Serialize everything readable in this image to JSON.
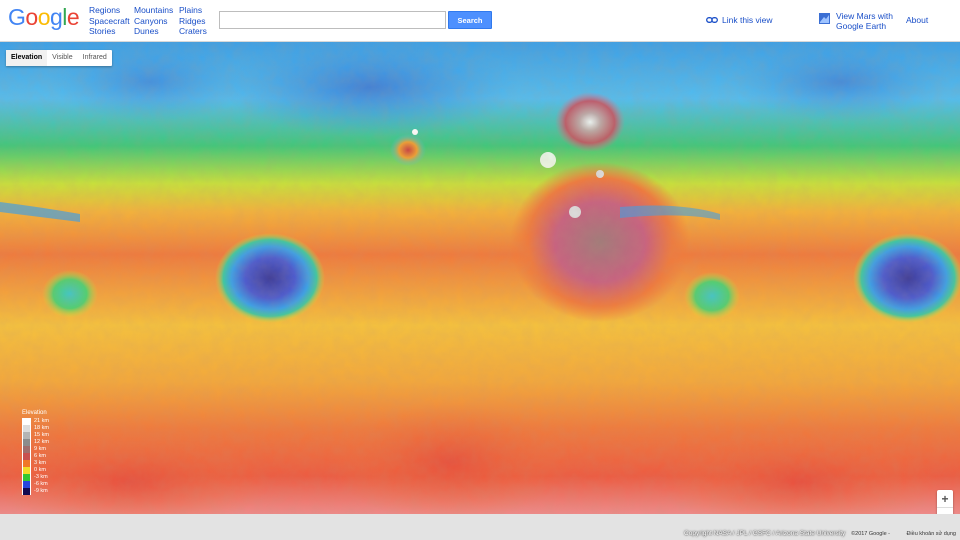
{
  "header": {
    "logo_letters": [
      "G",
      "o",
      "o",
      "g",
      "l",
      "e"
    ],
    "logo_colors": [
      "#4285f4",
      "#ea4335",
      "#fbbc05",
      "#4285f4",
      "#34a853",
      "#ea4335"
    ],
    "nav_col1": [
      "Regions",
      "Spacecraft",
      "Stories"
    ],
    "nav_col2": [
      "Mountains",
      "Canyons",
      "Dunes"
    ],
    "nav_col3": [
      "Plains",
      "Ridges",
      "Craters"
    ],
    "search_value": "",
    "search_button": "Search",
    "link_view": "Link this view",
    "earth_line1": "View Mars with",
    "earth_line2": "Google Earth",
    "about": "About"
  },
  "map_tabs": {
    "elevation": "Elevation",
    "visible": "Visible",
    "infrared": "Infrared",
    "selected": "Elevation"
  },
  "legend": {
    "title": "Elevation",
    "rows": [
      {
        "label": "21 km",
        "color": "#ffffff"
      },
      {
        "label": "18 km",
        "color": "#dcdcdc"
      },
      {
        "label": "15 km",
        "color": "#b4b4b4"
      },
      {
        "label": "12 km",
        "color": "#8c8c8c"
      },
      {
        "label": "9 km",
        "color": "#a06e6e"
      },
      {
        "label": "6 km",
        "color": "#c85050"
      },
      {
        "label": "3 km",
        "color": "#f07828"
      },
      {
        "label": "0 km",
        "color": "#f0dc28"
      },
      {
        "label": "-3 km",
        "color": "#32c832"
      },
      {
        "label": "-6 km",
        "color": "#2846dc"
      },
      {
        "label": "-9 km",
        "color": "#140a50"
      }
    ]
  },
  "zoom": {
    "in": "+",
    "out": "−"
  },
  "footer": {
    "copyright": "Copyright NASA / JPL / GSFC / Arizona State University",
    "google": "©2017 Google -",
    "terms": "Điều khoản sử dụng"
  },
  "icons": {
    "link": "link-icon",
    "earth": "google-earth-icon"
  }
}
